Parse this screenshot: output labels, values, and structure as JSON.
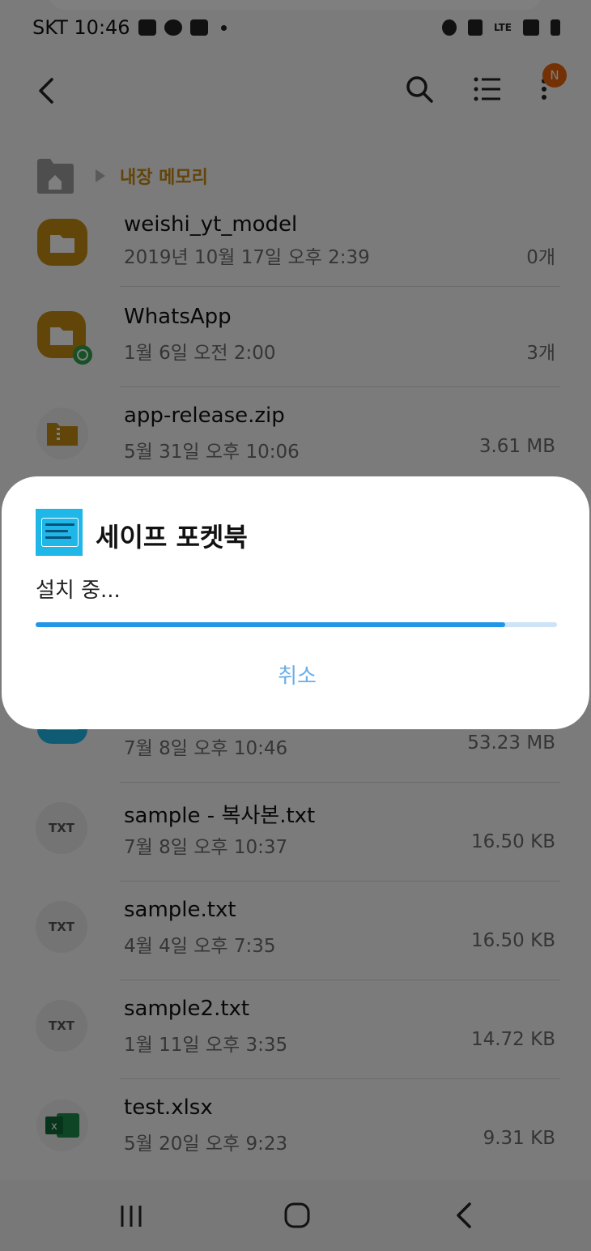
{
  "status_bar": {
    "carrier_time": "SKT 10:46",
    "network_label": "LTE"
  },
  "app_bar": {
    "notification_badge": "N"
  },
  "breadcrumb": {
    "location": "내장 메모리"
  },
  "files": [
    {
      "name": "weishi_yt_model",
      "meta": "2019년 10월 17일 오후 2:39",
      "size": "0개",
      "type": "folder"
    },
    {
      "name": "WhatsApp",
      "meta": "1월 6일 오전 2:00",
      "size": "3개",
      "type": "folder-whatsapp"
    },
    {
      "name": "app-release.zip",
      "meta": "5월 31일 오후 10:06",
      "size": "3.61 MB",
      "type": "zip"
    },
    {
      "name": "",
      "meta": "7월 8일 오후 10:46",
      "size": "53.23 MB",
      "type": "apk"
    },
    {
      "name": "sample - 복사본.txt",
      "meta": "7월 8일 오후 10:37",
      "size": "16.50 KB",
      "type": "txt"
    },
    {
      "name": "sample.txt",
      "meta": "4월 4일 오후 7:35",
      "size": "16.50 KB",
      "type": "txt"
    },
    {
      "name": "sample2.txt",
      "meta": "1월 11일 오후 3:35",
      "size": "14.72 KB",
      "type": "txt"
    },
    {
      "name": "test.xlsx",
      "meta": "5월 20일 오후 9:23",
      "size": "9.31 KB",
      "type": "xlsx"
    }
  ],
  "txt_label": "TXT",
  "dialog": {
    "app_name": "세이프 포켓북",
    "status": "설치 중...",
    "progress": 0.9,
    "cancel_label": "취소"
  },
  "colors": {
    "accent": "#2196e8",
    "folder": "#c58a13",
    "badge": "#e8620c",
    "app_icon": "#1fb6e8"
  }
}
